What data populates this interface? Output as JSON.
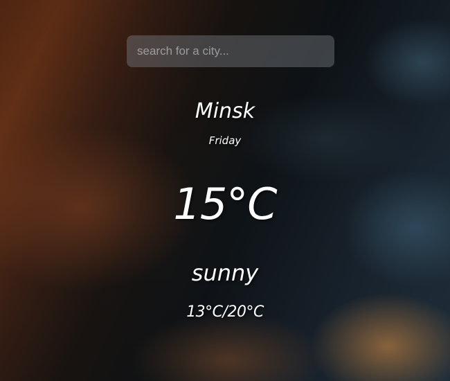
{
  "search": {
    "placeholder": "search for a city...",
    "value": ""
  },
  "weather": {
    "city": "Minsk",
    "day": "Friday",
    "temperature": "15°C",
    "condition": "sunny",
    "range": "13°C/20°C"
  },
  "colors": {
    "text": "#ffffff",
    "search_bg": "#787d82"
  }
}
